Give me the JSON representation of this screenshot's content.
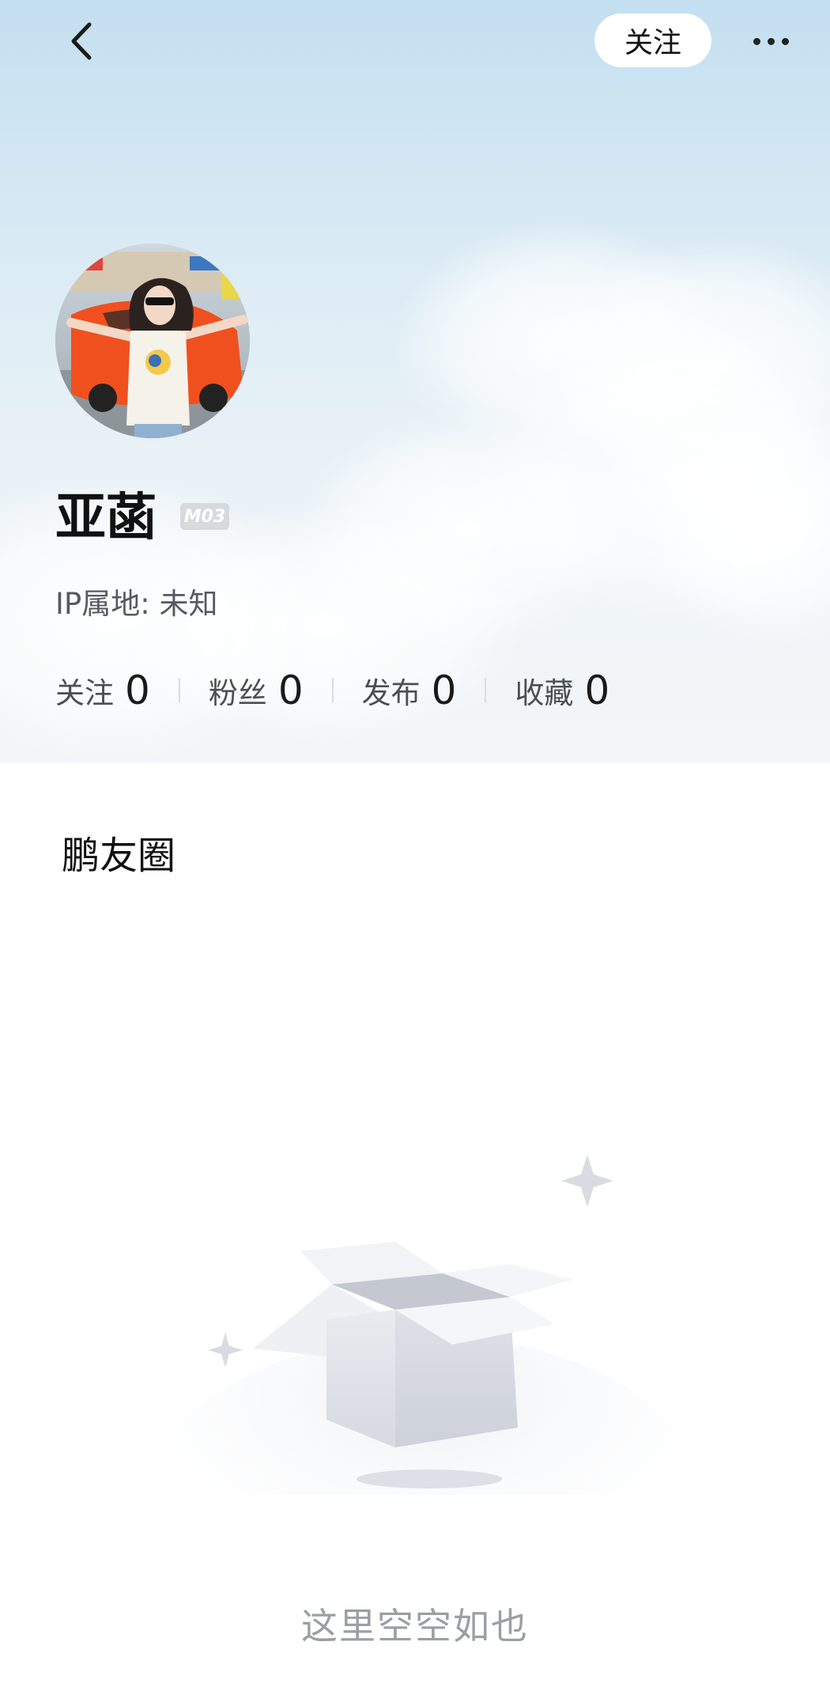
{
  "header": {
    "follow_label": "关注",
    "back_icon": "chevron-left-icon",
    "more_icon": "more-dots-icon"
  },
  "profile": {
    "name": "亚菡",
    "badge": "M03",
    "ip_location": "IP属地: 未知",
    "avatar": "profile-photo"
  },
  "stats": [
    {
      "label": "关注",
      "value": "0"
    },
    {
      "label": "粉丝",
      "value": "0"
    },
    {
      "label": "发布",
      "value": "0"
    },
    {
      "label": "收藏",
      "value": "0"
    }
  ],
  "content": {
    "section_title": "鹏友圈",
    "empty_text": "这里空空如也",
    "empty_icon": "empty-box-icon"
  },
  "colors": {
    "sky_top": "#c3dff0",
    "sky_bottom": "#f3f6f8",
    "text_primary": "#111111",
    "text_secondary": "#555a5e",
    "empty_text": "#9a9fa4"
  }
}
